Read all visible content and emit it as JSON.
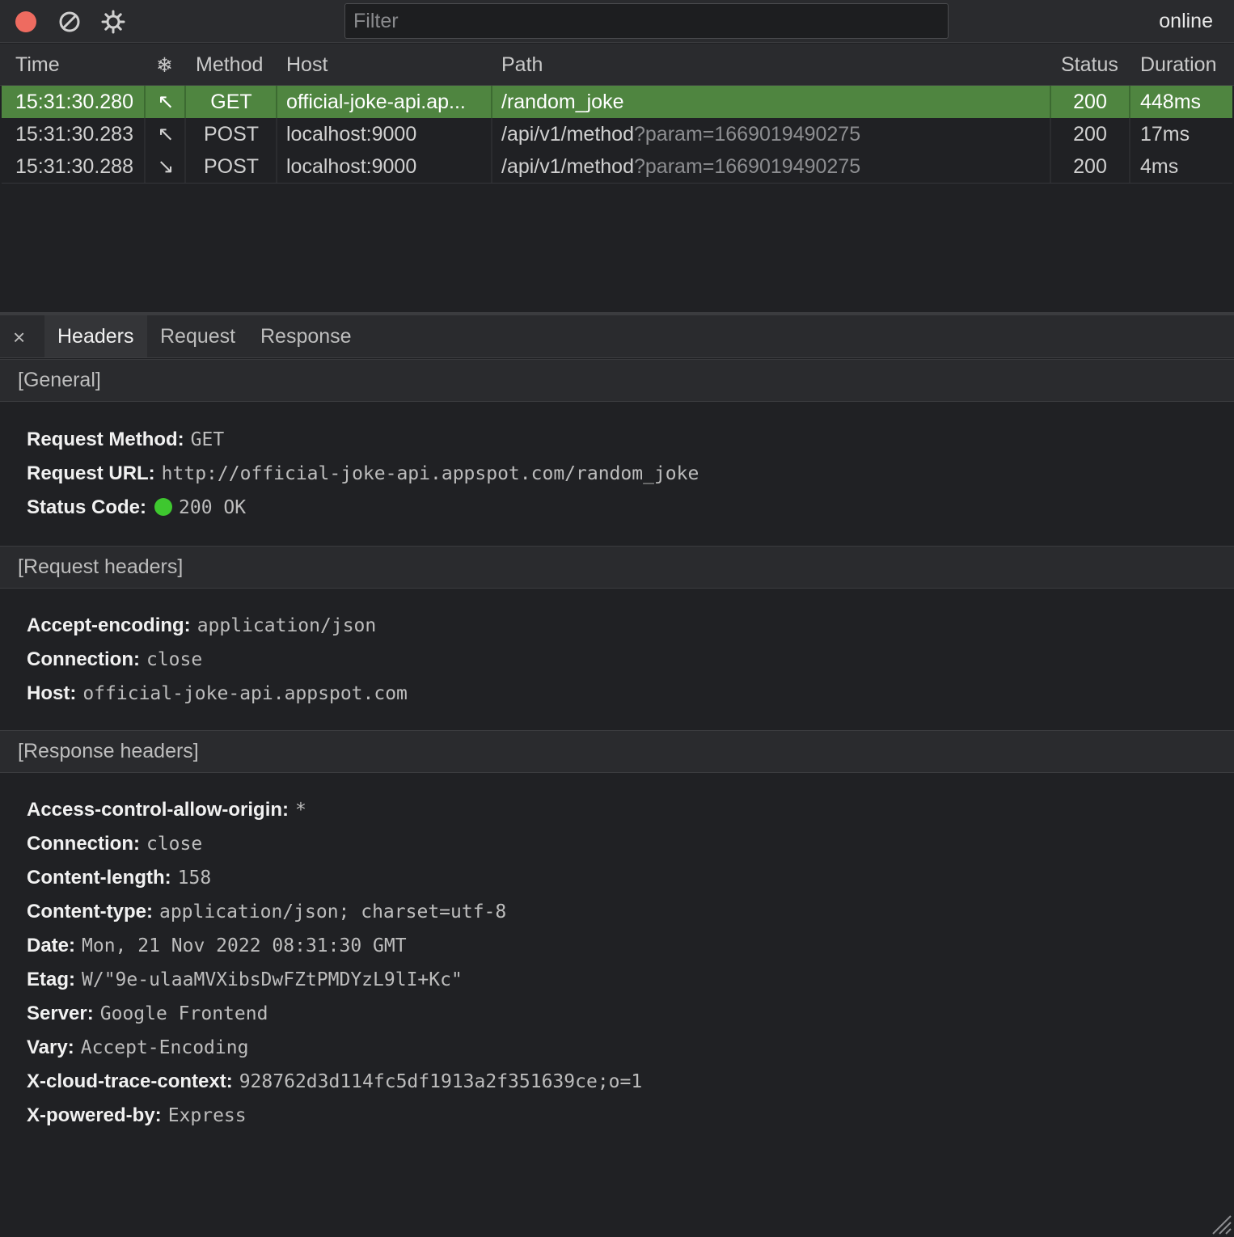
{
  "toolbar": {
    "filter_placeholder": "Filter",
    "status": "online",
    "icons": [
      "record-stop-icon",
      "clear-icon",
      "settings-gear-icon"
    ]
  },
  "grid": {
    "columns": [
      "Time",
      "❄",
      "Method",
      "Host",
      "Path",
      "Status",
      "Duration"
    ],
    "rows": [
      {
        "time": "15:31:30.280",
        "dir": "↖",
        "method": "GET",
        "host": "official-joke-api.ap...",
        "path": "/random_joke",
        "query": "",
        "status": "200",
        "duration": "448ms",
        "selected": true
      },
      {
        "time": "15:31:30.283",
        "dir": "↖",
        "method": "POST",
        "host": "localhost:9000",
        "path": "/api/v1/method",
        "query": "?param=1669019490275",
        "status": "200",
        "duration": "17ms",
        "selected": false
      },
      {
        "time": "15:31:30.288",
        "dir": "↘",
        "method": "POST",
        "host": "localhost:9000",
        "path": "/api/v1/method",
        "query": "?param=1669019490275",
        "status": "200",
        "duration": "4ms",
        "selected": false
      }
    ]
  },
  "details": {
    "close": "×",
    "tabs": [
      "Headers",
      "Request",
      "Response"
    ],
    "active_tab": "Headers",
    "general": {
      "title": "[General]",
      "items": [
        {
          "k": "Request Method:",
          "v": "GET"
        },
        {
          "k": "Request URL:",
          "v": "http://official-joke-api.appspot.com/random_joke"
        },
        {
          "k": "Status Code:",
          "v": "200 OK"
        }
      ]
    },
    "request_headers": {
      "title": "[Request headers]",
      "items": [
        {
          "k": "Accept-encoding:",
          "v": "application/json"
        },
        {
          "k": "Connection:",
          "v": "close"
        },
        {
          "k": "Host:",
          "v": "official-joke-api.appspot.com"
        }
      ]
    },
    "response_headers": {
      "title": "[Response headers]",
      "items": [
        {
          "k": "Access-control-allow-origin:",
          "v": "*"
        },
        {
          "k": "Connection:",
          "v": "close"
        },
        {
          "k": "Content-length:",
          "v": "158"
        },
        {
          "k": "Content-type:",
          "v": "application/json; charset=utf-8"
        },
        {
          "k": "Date:",
          "v": "Mon, 21 Nov 2022 08:31:30 GMT"
        },
        {
          "k": "Etag:",
          "v": "W/\"9e-ulaaMVXibsDwFZtPMDYzL9lI+Kc\""
        },
        {
          "k": "Server:",
          "v": "Google Frontend"
        },
        {
          "k": "Vary:",
          "v": "Accept-Encoding"
        },
        {
          "k": "X-cloud-trace-context:",
          "v": "928762d3d114fc5df1913a2f351639ce;o=1"
        },
        {
          "k": "X-powered-by:",
          "v": "Express"
        }
      ]
    }
  },
  "colors": {
    "selected_row": "#4f8540",
    "status_ok": "#3ec72f",
    "close_dot": "#ee6b60"
  }
}
